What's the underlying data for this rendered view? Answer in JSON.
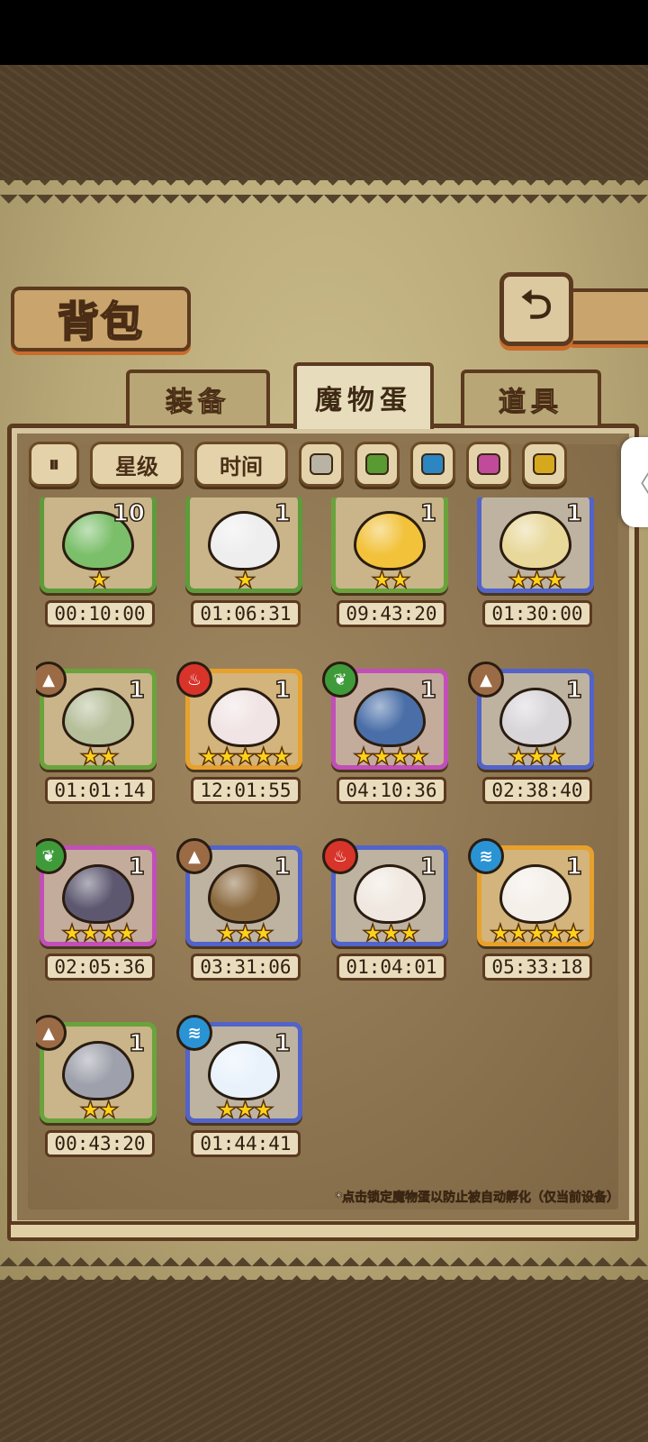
{
  "screen": {
    "title": "背包",
    "back_icon": "return-arrow-icon"
  },
  "tabs": [
    {
      "label": "装备",
      "active": false
    },
    {
      "label": "魔物蛋",
      "active": true
    },
    {
      "label": "道具",
      "active": false
    }
  ],
  "filters": {
    "sort_icon": "sort-toggle-icon",
    "star_label": "星级",
    "time_label": "时间",
    "colors": [
      "#b9b3a3",
      "#5a9a33",
      "#2b86c2",
      "#c24a9a",
      "#d6a81e"
    ]
  },
  "eggs": [
    {
      "count": "10",
      "stars": 1,
      "timer": "00:10:00",
      "rarity": 1,
      "element": "",
      "color": "#7bbf6a"
    },
    {
      "count": "1",
      "stars": 1,
      "timer": "01:06:31",
      "rarity": 1,
      "element": "",
      "color": "#eeeeee"
    },
    {
      "count": "1",
      "stars": 2,
      "timer": "09:43:20",
      "rarity": 2,
      "element": "",
      "color": "#f2c23a"
    },
    {
      "count": "1",
      "stars": 3,
      "timer": "01:30:00",
      "rarity": 3,
      "element": "",
      "color": "#e8d89a"
    },
    {
      "count": "1",
      "stars": 2,
      "timer": "01:01:14",
      "rarity": 2,
      "element": "earth",
      "color": "#b6bf9a"
    },
    {
      "count": "1",
      "stars": 5,
      "timer": "12:01:55",
      "rarity": 5,
      "element": "fire",
      "color": "#f1e4e4"
    },
    {
      "count": "1",
      "stars": 4,
      "timer": "04:10:36",
      "rarity": 4,
      "element": "nature",
      "color": "#4a6fa8"
    },
    {
      "count": "1",
      "stars": 3,
      "timer": "02:38:40",
      "rarity": 3,
      "element": "earth",
      "color": "#d9d6da"
    },
    {
      "count": "1",
      "stars": 4,
      "timer": "02:05:36",
      "rarity": 4,
      "element": "nature",
      "color": "#5d5870"
    },
    {
      "count": "1",
      "stars": 3,
      "timer": "03:31:06",
      "rarity": 3,
      "element": "earth",
      "color": "#8c6a3f"
    },
    {
      "count": "1",
      "stars": 3,
      "timer": "01:04:01",
      "rarity": 3,
      "element": "fire",
      "color": "#f0e8e0"
    },
    {
      "count": "1",
      "stars": 5,
      "timer": "05:33:18",
      "rarity": 5,
      "element": "water",
      "color": "#f4efe9"
    },
    {
      "count": "1",
      "stars": 2,
      "timer": "00:43:20",
      "rarity": 2,
      "element": "earth",
      "color": "#9ea0ab"
    },
    {
      "count": "1",
      "stars": 3,
      "timer": "01:44:41",
      "rarity": 3,
      "element": "water",
      "color": "#e9f2fb"
    }
  ],
  "footnote": "*点击锁定魔物蛋以防止被自动孵化（仅当前设备）"
}
